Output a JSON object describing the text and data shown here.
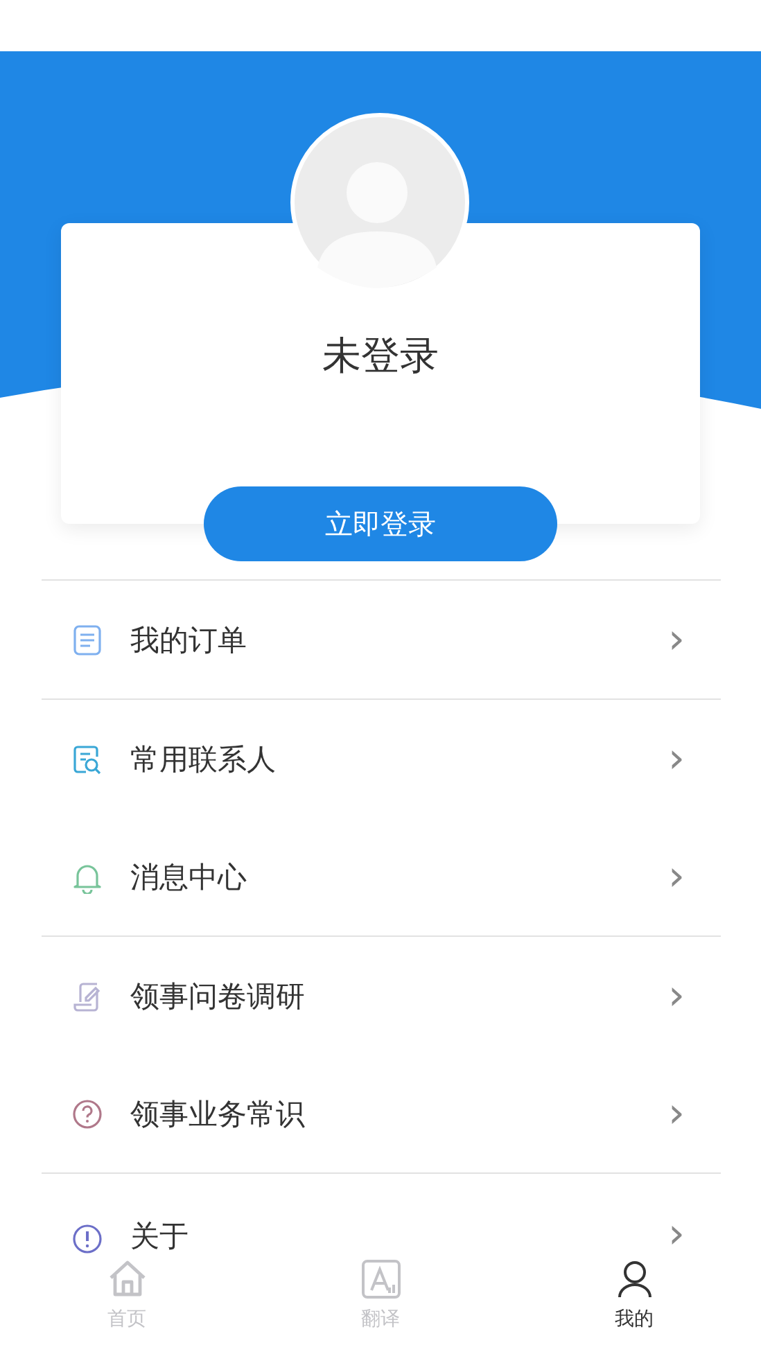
{
  "profile": {
    "name": "未登录",
    "login_button": "立即登录"
  },
  "menu_groups": [
    {
      "items": [
        {
          "kind": "order",
          "label": "我的订单",
          "chevron": "›"
        }
      ]
    },
    {
      "items": [
        {
          "kind": "contacts",
          "label": "常用联系人",
          "chevron": "›"
        },
        {
          "kind": "bell",
          "label": "消息中心",
          "chevron": "›"
        }
      ]
    },
    {
      "items": [
        {
          "kind": "survey",
          "label": "领事问卷调研",
          "chevron": "›"
        },
        {
          "kind": "question",
          "label": "领事业务常识",
          "chevron": "›"
        }
      ]
    },
    {
      "items": [
        {
          "kind": "about",
          "label": "关于",
          "chevron": "›"
        }
      ]
    }
  ],
  "tabs": [
    {
      "kind": "home",
      "label": "首页",
      "selected": false
    },
    {
      "kind": "translate",
      "label": "翻译",
      "selected": false
    },
    {
      "kind": "me",
      "label": "我的",
      "selected": true
    }
  ]
}
